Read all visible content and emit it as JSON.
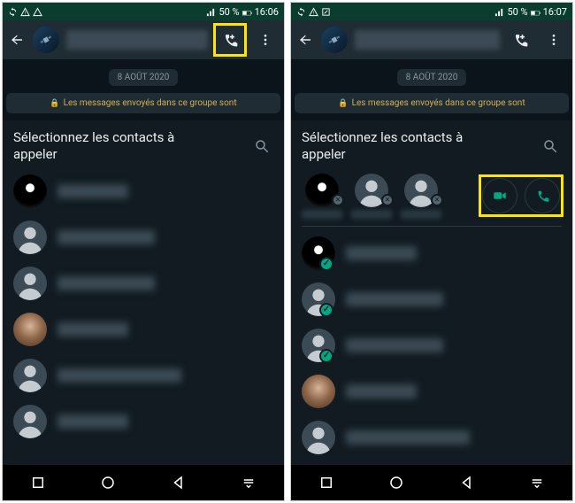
{
  "screens": [
    {
      "status": {
        "battery_pct": "50 %",
        "time": "16:06"
      },
      "date_chip": "8 AOÛT 2020",
      "encryption_banner": "Les messages envoyés dans ce groupe sont",
      "picker_title": "Sélectionnez les contacts à appeler"
    },
    {
      "status": {
        "battery_pct": "50 %",
        "time": "16:07"
      },
      "date_chip": "8 AOÛT 2020",
      "encryption_banner": "Les messages envoyés dans ce groupe sont",
      "picker_title": "Sélectionnez les contacts à appeler"
    }
  ]
}
